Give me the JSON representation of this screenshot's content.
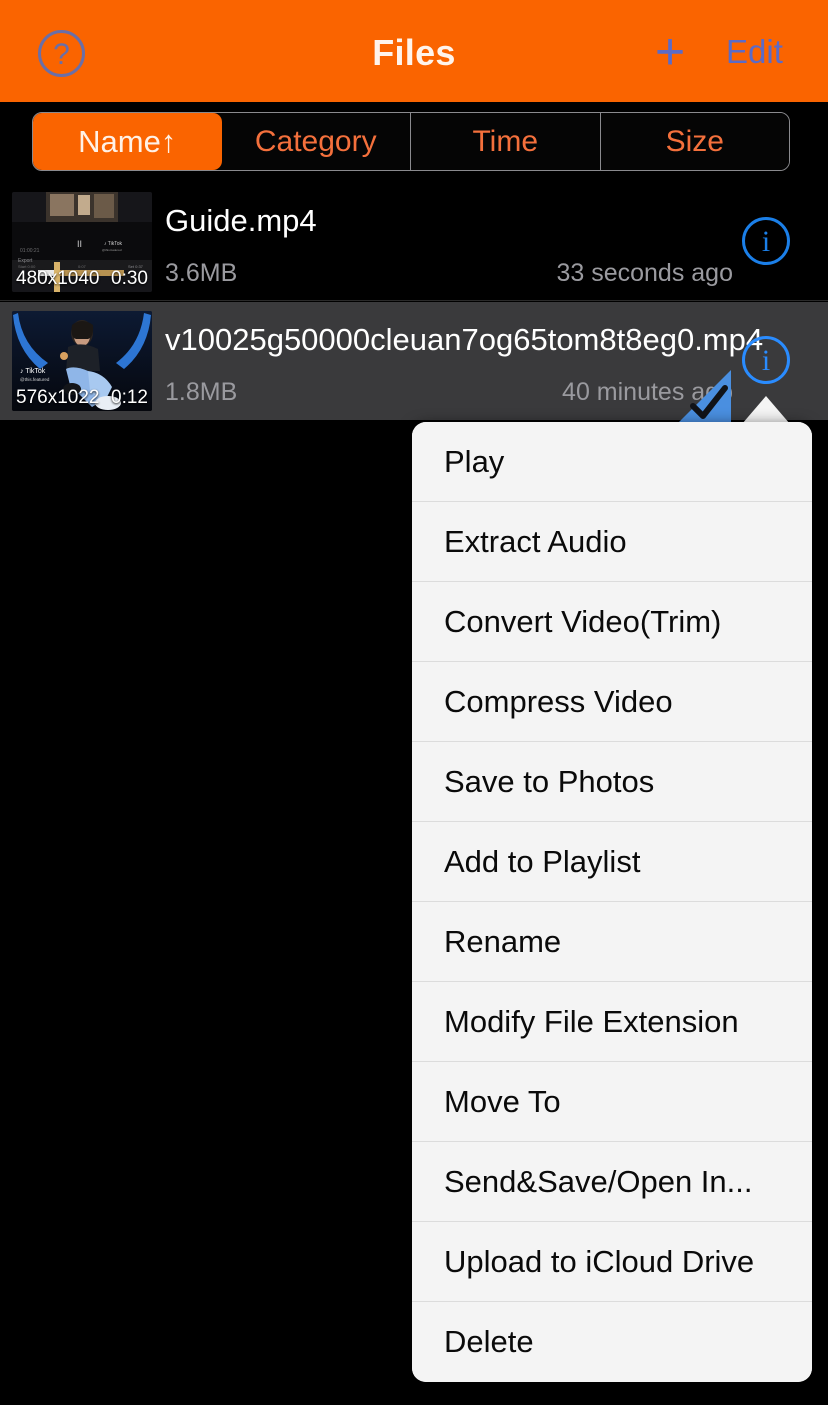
{
  "navbar": {
    "help_icon": "question-circle-icon",
    "title": "Files",
    "add_icon": "+",
    "edit_label": "Edit",
    "bg_color": "#FA6400",
    "action_color": "#5B6BC8"
  },
  "segmented_control": {
    "options": [
      {
        "label": "Name↑",
        "active": true
      },
      {
        "label": "Category",
        "active": false
      },
      {
        "label": "Time",
        "active": false
      },
      {
        "label": "Size",
        "active": false
      }
    ],
    "active_bg": "#FA6400",
    "inactive_text": "#F4703C"
  },
  "files": [
    {
      "name": "Guide.mp4",
      "size": "3.6MB",
      "time": "33 seconds ago",
      "resolution": "480x1040",
      "duration": "0:30",
      "selected": false,
      "info_icon": "info-circle-icon"
    },
    {
      "name": "v10025g50000cleuan7og65tom8t8eg0.mp4",
      "size": "1.8MB",
      "time": "40 minutes ago",
      "resolution": "576x1022",
      "duration": "0:12",
      "selected": true,
      "info_icon": "info-circle-icon",
      "selection_icon": "checkmark-flag-icon"
    }
  ],
  "context_menu": {
    "items": [
      {
        "label": "Play"
      },
      {
        "label": "Extract Audio"
      },
      {
        "label": "Convert Video(Trim)"
      },
      {
        "label": "Compress Video"
      },
      {
        "label": "Save to Photos"
      },
      {
        "label": "Add to Playlist"
      },
      {
        "label": "Rename"
      },
      {
        "label": "Modify File Extension"
      },
      {
        "label": "Move To"
      },
      {
        "label": "Send&Save/Open In..."
      },
      {
        "label": "Upload to iCloud Drive"
      },
      {
        "label": "Delete"
      }
    ],
    "bg_color": "#F4F4F4",
    "text_color": "#0A0A0A"
  }
}
